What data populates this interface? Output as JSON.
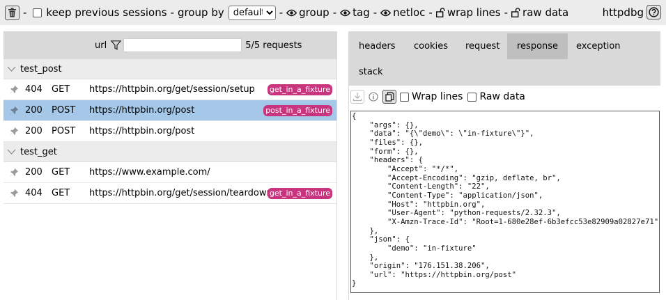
{
  "toolbar": {
    "keep_sessions_label": "keep previous sessions",
    "group_by_label": "group by",
    "group_by_value": "default",
    "toggle_group": "group",
    "toggle_tag": "tag",
    "toggle_netloc": "netloc",
    "wrap_lines": "wrap lines",
    "raw_data": "raw data",
    "separator": "-",
    "app_name": "httpdbg"
  },
  "request_list": {
    "filter_label": "url",
    "filter_placeholder": "",
    "count": "5/5 requests",
    "groups": [
      {
        "name": "test_post",
        "rows": [
          {
            "status": "404",
            "method": "GET",
            "url": "https://httpbin.org/get/session/setup",
            "tag": "get_in_a_fixture",
            "selected": false
          },
          {
            "status": "200",
            "method": "POST",
            "url": "https://httpbin.org/post",
            "tag": "post_in_a_fixture",
            "selected": true
          },
          {
            "status": "200",
            "method": "POST",
            "url": "https://httpbin.org/post",
            "tag": "",
            "selected": false
          }
        ]
      },
      {
        "name": "test_get",
        "rows": [
          {
            "status": "200",
            "method": "GET",
            "url": "https://www.example.com/",
            "tag": "",
            "selected": false
          },
          {
            "status": "404",
            "method": "GET",
            "url": "https://httpbin.org/get/session/teardown",
            "tag": "get_in_a_fixture",
            "selected": false
          }
        ]
      }
    ]
  },
  "detail": {
    "tabs": [
      "headers",
      "cookies",
      "request",
      "response",
      "exception",
      "stack"
    ],
    "active_tab": "response",
    "wrap_lines_label": "Wrap lines",
    "raw_data_label": "Raw data",
    "body": "{\n    \"args\": {},\n    \"data\": \"{\\\"demo\\\": \\\"in-fixture\\\"}\",\n    \"files\": {},\n    \"form\": {},\n    \"headers\": {\n        \"Accept\": \"*/*\",\n        \"Accept-Encoding\": \"gzip, deflate, br\",\n        \"Content-Length\": \"22\",\n        \"Content-Type\": \"application/json\",\n        \"Host\": \"httpbin.org\",\n        \"User-Agent\": \"python-requests/2.32.3\",\n        \"X-Amzn-Trace-Id\": \"Root=1-680e28ef-6b3efcc53e82909a02827e71\"\n    },\n    \"json\": {\n        \"demo\": \"in-fixture\"\n    },\n    \"origin\": \"176.151.38.206\",\n    \"url\": \"https://httpbin.org/post\"\n}"
  },
  "colors": {
    "selected_row": "#a5c8e8",
    "tag_badge": "#c9347e",
    "header_bar": "#d9d9d9",
    "top_bar": "#ececec"
  }
}
